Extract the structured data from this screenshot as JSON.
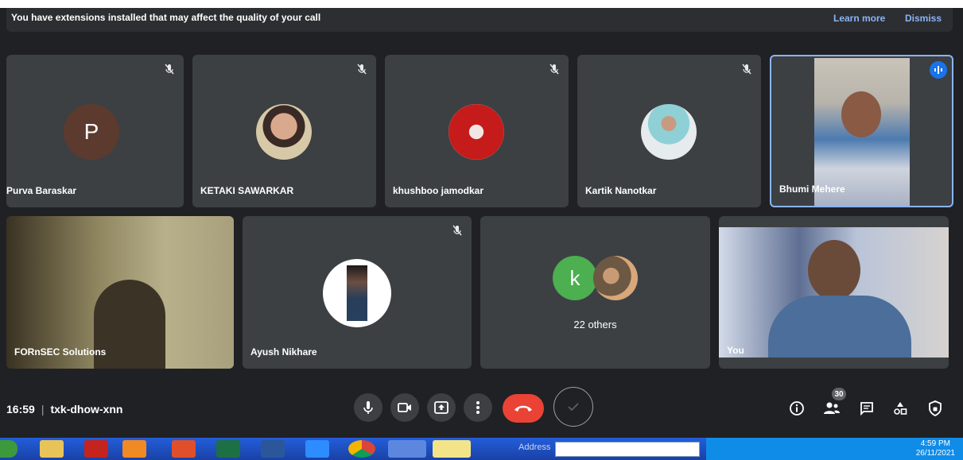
{
  "banner": {
    "message": "You have extensions installed that may affect the quality of your call",
    "learn_more": "Learn more",
    "dismiss": "Dismiss"
  },
  "participants": [
    {
      "name": "Purva Baraskar",
      "initial": "P",
      "avatar_color": "#5d3a2e",
      "muted": true
    },
    {
      "name": "KETAKI SAWARKAR",
      "muted": true
    },
    {
      "name": "khushboo jamodkar",
      "muted": true
    },
    {
      "name": "Kartik Nanotkar",
      "muted": true
    },
    {
      "name": "Bhumi Mehere",
      "speaking": true
    },
    {
      "name": "FORnSEC Solutions"
    },
    {
      "name": "Ayush Nikhare",
      "muted": true
    },
    {
      "others_initial": "k",
      "others_label": "22 others",
      "avatar_color": "#4caf50"
    },
    {
      "name": "You"
    }
  ],
  "bottom": {
    "time": "16:59",
    "meeting_code": "txk-dhow-xnn",
    "people_count": "30"
  },
  "taskbar": {
    "address_label": "Address",
    "time": "4:59 PM",
    "date": "26/11/2021"
  },
  "colors": {
    "background": "#202124",
    "tile": "#3c4043",
    "accent": "#8ab4f8",
    "hangup": "#ea4335",
    "taskbar": "#245edb"
  },
  "icons": [
    "mic-off-icon",
    "mic-icon",
    "camera-icon",
    "present-icon",
    "more-icon",
    "hangup-icon",
    "check-icon",
    "info-icon",
    "people-icon",
    "chat-icon",
    "activities-icon",
    "host-controls-icon"
  ]
}
